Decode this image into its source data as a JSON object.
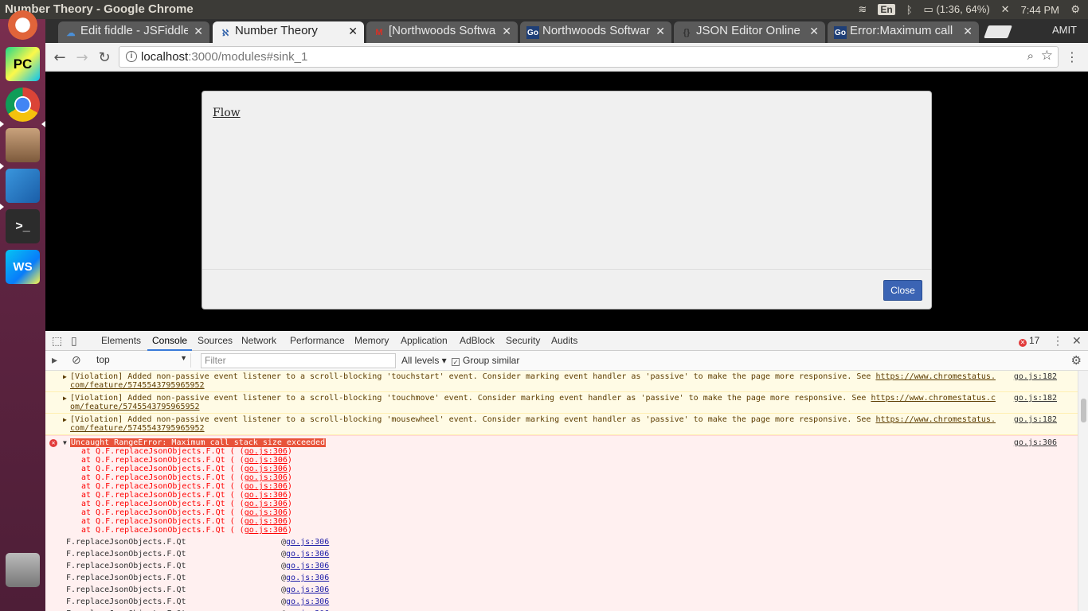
{
  "window": {
    "title": "Number Theory - Google Chrome"
  },
  "tray": {
    "lang": "En",
    "battery": "(1:36, 64%)",
    "time": "7:44 PM"
  },
  "launcher": [
    {
      "name": "ubuntu-dash-icon",
      "label": "",
      "color": "#d7480f"
    },
    {
      "name": "pycharm-icon",
      "label": "PC",
      "color": "#21d789"
    },
    {
      "name": "chrome-icon",
      "label": "",
      "color": "#fff"
    },
    {
      "name": "files-icon",
      "label": "",
      "color": "#a8866a"
    },
    {
      "name": "vscode-icon",
      "label": "",
      "color": "#2a70b5"
    },
    {
      "name": "terminal-icon",
      "label": ">_",
      "color": "#2c2c2c"
    },
    {
      "name": "webstorm-icon",
      "label": "WS",
      "color": "#1e9fe0"
    },
    {
      "name": "trash-icon",
      "label": "",
      "color": "#777"
    }
  ],
  "tabs": [
    {
      "fav": "☁",
      "label": "Edit fiddle - JSFiddle",
      "active": false,
      "favcolor": "#4a90d9"
    },
    {
      "fav": "ℵ",
      "label": "Number Theory",
      "active": true,
      "favcolor": "#2a5da8"
    },
    {
      "fav": "M",
      "label": "[Northwoods Software]",
      "active": false,
      "favcolor": "#d93025"
    },
    {
      "fav": "Go",
      "label": "Northwoods Software",
      "active": false,
      "favcolor": "#1f3f77"
    },
    {
      "fav": "{}",
      "label": "JSON Editor Online",
      "active": false,
      "favcolor": "#333"
    },
    {
      "fav": "Go",
      "label": "Error:Maximum call",
      "active": false,
      "favcolor": "#1f3f77"
    }
  ],
  "profile": "AMIT",
  "omnibox": {
    "host": "localhost",
    "path": ":3000/modules#sink_1"
  },
  "modal": {
    "link": "Flow",
    "close_label": "Close"
  },
  "devtools": {
    "tabs": [
      "Elements",
      "Console",
      "Sources",
      "Network",
      "Performance",
      "Memory",
      "Application",
      "AdBlock",
      "Security",
      "Audits"
    ],
    "selected_tab": "Console",
    "error_count": "17",
    "context": "top",
    "filter_placeholder": "Filter",
    "levels": "All levels ▾",
    "group_similar": "Group similar"
  },
  "console": {
    "violations": [
      {
        "text": "[Violation] Added non-passive event listener to a scroll-blocking 'touchstart' event. Consider marking event handler as 'passive' to make the page more responsive. See ",
        "link": "https://www.chromestatus.com/feature/5745543795965952",
        "src": "go.js:182"
      },
      {
        "text": "[Violation] Added non-passive event listener to a scroll-blocking 'touchmove' event. Consider marking event handler as 'passive' to make the page more responsive. See ",
        "link": "https://www.chromestatus.com/feature/5745543795965952",
        "src": "go.js:182"
      },
      {
        "text": "[Violation] Added non-passive event listener to a scroll-blocking 'mousewheel' event. Consider marking event handler as 'passive' to make the page more responsive. See ",
        "link": "https://www.chromestatus.com/feature/5745543795965952",
        "src": "go.js:182"
      }
    ],
    "error": {
      "head": "Uncaught RangeError: Maximum call stack size exceeded",
      "src": "go.js:306",
      "stack_prefix": "    at Q.F.replaceJsonObjects.F.Qt (",
      "stack_link": "go.js:306",
      "stack_count": 10
    },
    "calls": [
      {
        "fn": "F.replaceJsonObjects.F.Qt",
        "at": "@",
        "link": "go.js:306"
      },
      {
        "fn": "F.replaceJsonObjects.F.Qt",
        "at": "@",
        "link": "go.js:306"
      },
      {
        "fn": "F.replaceJsonObjects.F.Qt",
        "at": "@",
        "link": "go.js:306"
      },
      {
        "fn": "F.replaceJsonObjects.F.Qt",
        "at": "@",
        "link": "go.js:306"
      },
      {
        "fn": "F.replaceJsonObjects.F.Qt",
        "at": "@",
        "link": "go.js:306"
      },
      {
        "fn": "F.replaceJsonObjects.F.Qt",
        "at": "@",
        "link": "go.js:306"
      },
      {
        "fn": "F.replaceJsonObjects.F.Qt",
        "at": "@",
        "link": "go.js:306"
      }
    ]
  }
}
